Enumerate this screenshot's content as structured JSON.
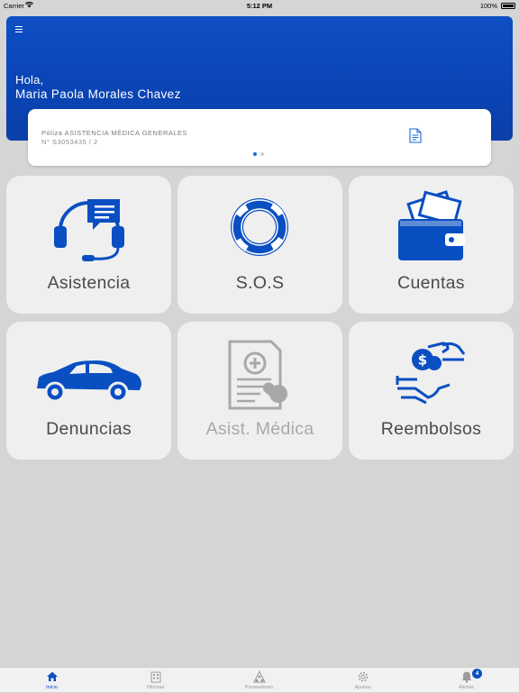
{
  "status_bar": {
    "carrier": "Carrier",
    "time": "5:12 PM",
    "battery": "100%"
  },
  "header": {
    "greeting": "Hola,",
    "user_name": "Maria Paola Morales Chavez"
  },
  "policy_card": {
    "title": "Póliza ASISTENCIA MÉDICA GENERALES",
    "number": "N° S3053435 / 2",
    "page_count": 2,
    "active_page": 1
  },
  "tiles": [
    {
      "label": "Asistencia",
      "icon": "headset-chat-icon",
      "enabled": true
    },
    {
      "label": "S.O.S",
      "icon": "lifebuoy-icon",
      "enabled": true
    },
    {
      "label": "Cuentas",
      "icon": "wallet-icon",
      "enabled": true
    },
    {
      "label": "Denuncias",
      "icon": "car-icon",
      "enabled": true
    },
    {
      "label": "Asist. Médica",
      "icon": "medical-report-icon",
      "enabled": false
    },
    {
      "label": "Reembolsos",
      "icon": "refund-hands-icon",
      "enabled": true
    }
  ],
  "tab_bar": {
    "items": [
      {
        "label": "Inicio",
        "icon": "home-icon",
        "active": true
      },
      {
        "label": "Oficinas",
        "icon": "building-icon",
        "active": false
      },
      {
        "label": "Proveedores",
        "icon": "providers-icon",
        "active": false
      },
      {
        "label": "Ajustes",
        "icon": "gear-icon",
        "active": false
      },
      {
        "label": "Alertas",
        "icon": "bell-icon",
        "active": false,
        "badge": "4"
      }
    ]
  },
  "colors": {
    "primary_blue": "#0a4fc2",
    "tile_bg": "#efefef",
    "page_bg": "#d5d5d5",
    "disabled_gray": "#a8a8a8"
  }
}
